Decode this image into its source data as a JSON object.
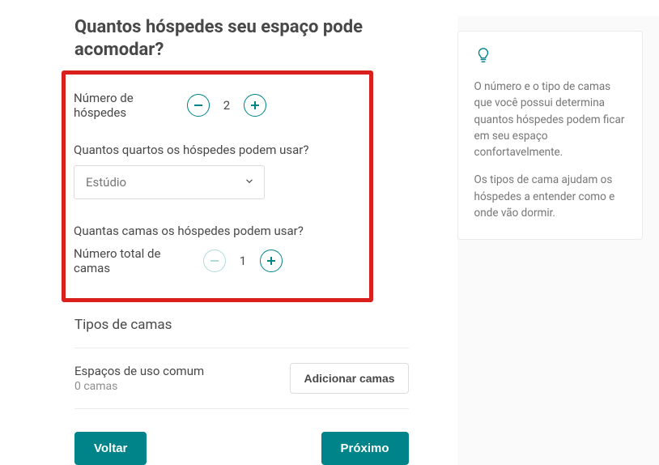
{
  "title": "Quantos hóspedes seu espaço pode acomodar?",
  "guests": {
    "label": "Número de hóspedes",
    "value": "2"
  },
  "bedrooms": {
    "question": "Quantos quartos os hóspedes podem usar?",
    "selected": "Estúdio"
  },
  "beds": {
    "question": "Quantas camas os hóspedes podem usar?",
    "label": "Número total de camas",
    "value": "1"
  },
  "bed_types_title": "Tipos de camas",
  "common": {
    "title": "Espaços de uso comum",
    "subtitle": "0 camas",
    "button": "Adicionar camas"
  },
  "nav": {
    "back": "Voltar",
    "next": "Próximo"
  },
  "tip": {
    "p1": "O número e o tipo de camas que você possui determina quantos hóspedes podem ficar em seu espaço confortavelmente.",
    "p2": "Os tipos de cama ajudam os hóspedes a entender como e onde vão dormir."
  }
}
